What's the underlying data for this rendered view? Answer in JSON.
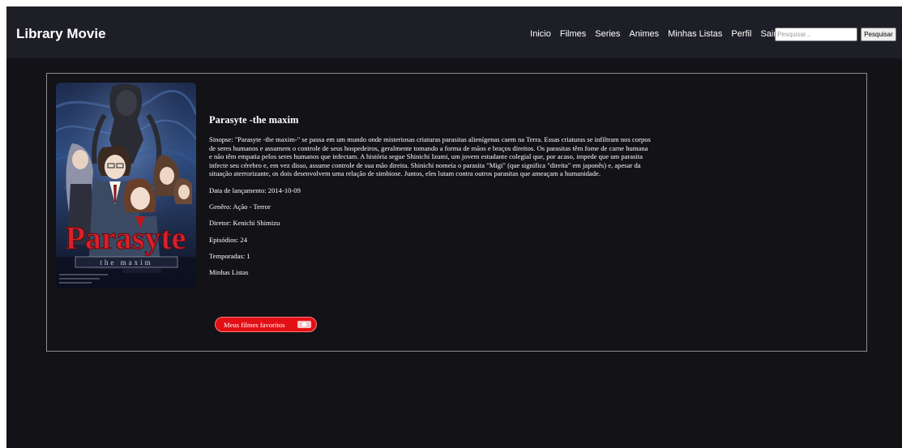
{
  "app": {
    "brand": "Library Movie"
  },
  "nav": {
    "links": [
      "Inicio",
      "Filmes",
      "Series",
      "Animes",
      "Minhas Listas",
      "Perfil",
      "Sair"
    ],
    "search_placeholder": "Pesquisar...",
    "search_button": "Pesquisar"
  },
  "poster": {
    "logo_text": "Parasyte",
    "logo_subtitle": "the maxim"
  },
  "item": {
    "title": "Parasyte -the maxim",
    "synopsis": "Sinopse: \"Parasyte -the maxim-\" se passa em um mundo onde misteriosas criaturas parasitas alienígenas caem na Terra. Essas criaturas se infiltram nos corpos de seres humanos e assumem o controle de seus hospedeiros, geralmente tomando a forma de mãos e braços direitos. Os parasitas têm fome de carne humana e não têm empatia pelos seres humanos que infectam. A história segue Shinichi Izumi, um jovem estudante colegial que, por acaso, impede que um parasita infecte seu cérebro e, em vez disso, assume controle de sua mão direita. Shinichi nomeia o parasita \"Migi\" (que significa \"direita\" em japonês) e, apesar da situação aterrorizante, os dois desenvolvem uma relação de simbiose. Juntos, eles lutam contra outros parasitas que ameaçam a humanidade.",
    "release_date": "Data de lançamento: 2014-10-09",
    "genre": "Genêro: Ação - Terror",
    "director": "Diretor: Kenichi Shimizu",
    "episodes": "Episódios: 24",
    "seasons": "Temporadas: 1",
    "lists_label": "Minhas Listas",
    "list_button": "Meus filmes favoritos"
  },
  "colors": {
    "page_bg": "#121217",
    "navbar_bg": "#1e1f26",
    "card_border": "#8e8e92",
    "accent_red": "#e21015"
  }
}
